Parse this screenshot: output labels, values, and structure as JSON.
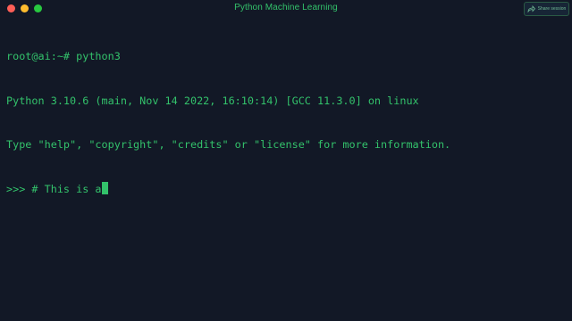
{
  "window": {
    "title": "Python Machine Learning",
    "share_label": "Share session"
  },
  "colors": {
    "background": "#121826",
    "text": "#33c26b",
    "close": "#ff5f57",
    "minimize": "#febc2e",
    "maximize": "#28c840"
  },
  "icons": {
    "share": "share-arrow-icon"
  },
  "terminal": {
    "lines": [
      "root@ai:~# python3",
      "Python 3.10.6 (main, Nov 14 2022, 16:10:14) [GCC 11.3.0] on linux",
      "Type \"help\", \"copyright\", \"credits\" or \"license\" for more information.",
      ">>> # This is a"
    ]
  }
}
